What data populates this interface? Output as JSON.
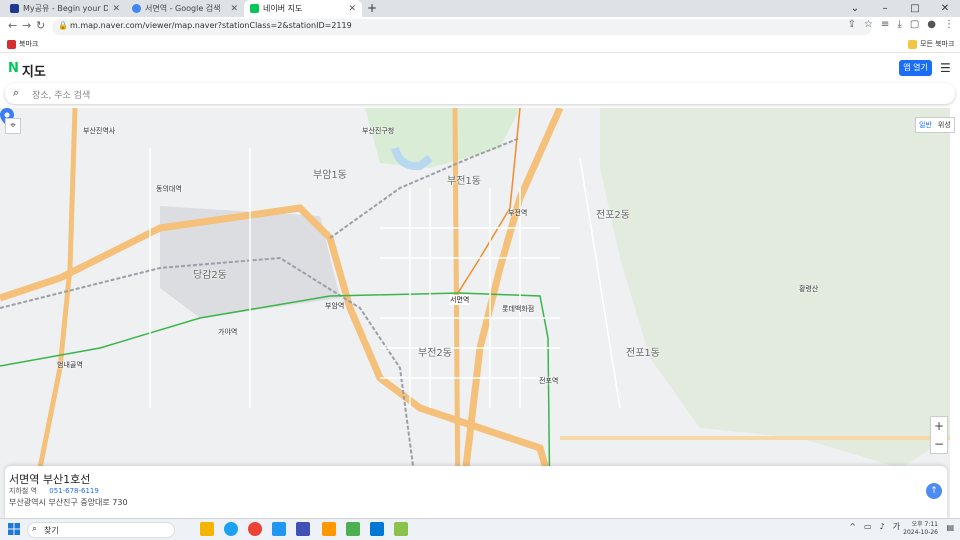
{
  "browser": {
    "tabs": [
      {
        "title": "My공유 - Begin your Download",
        "active": false,
        "color": "#1e3a8a"
      },
      {
        "title": "서면역 - Google 검색",
        "active": false,
        "color": "#4285f4"
      },
      {
        "title": "네이버 지도",
        "active": true,
        "color": "#03c75a"
      }
    ],
    "url": "m.map.naver.com/viewer/map.naver?stationClass=2&stationID=2119",
    "bookmarks": [
      {
        "label": "북마크",
        "color": "#d32f2f"
      },
      {
        "label": "모든 북마크",
        "color": "#f4c542"
      }
    ]
  },
  "header": {
    "logo_n": "N",
    "logo_text": "지도",
    "open_app": "앱 열기"
  },
  "search": {
    "placeholder": "장소, 주소 검색"
  },
  "map": {
    "map_types": [
      "일반",
      "위성"
    ],
    "labels": [
      {
        "text": "부암1동",
        "cls": "dist"
      },
      {
        "text": "당감2동",
        "cls": "dist"
      },
      {
        "text": "부전1동",
        "cls": "dist"
      },
      {
        "text": "전포2동",
        "cls": "dist"
      },
      {
        "text": "전포1동",
        "cls": "dist"
      },
      {
        "text": "부전2동",
        "cls": "dist"
      },
      {
        "text": "서면역",
        "cls": ""
      },
      {
        "text": "부전역",
        "cls": ""
      },
      {
        "text": "부암역",
        "cls": ""
      },
      {
        "text": "가야역",
        "cls": ""
      },
      {
        "text": "범내골역",
        "cls": ""
      },
      {
        "text": "전포역",
        "cls": ""
      },
      {
        "text": "롯데백화점",
        "cls": ""
      },
      {
        "text": "부산진구청",
        "cls": ""
      },
      {
        "text": "동의대역",
        "cls": ""
      },
      {
        "text": "황령산",
        "cls": ""
      },
      {
        "text": "부산진역사",
        "cls": ""
      }
    ],
    "station_pin": "서면역"
  },
  "card": {
    "name": "서면역 부산1호선",
    "category": "지하철 역",
    "phone": "051-678-6119",
    "address": "부산광역시 부산진구 중앙대로 730"
  },
  "taskbar": {
    "search_text": "찾기",
    "time": "오후 7:11",
    "date": "2024-10-26"
  }
}
